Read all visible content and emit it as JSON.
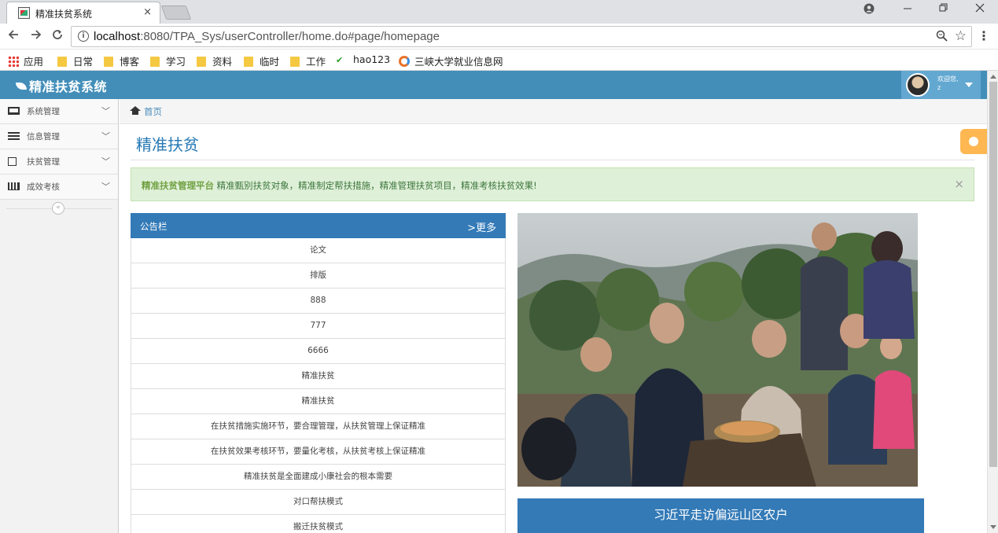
{
  "browser": {
    "tab_title": "精准扶贫系统",
    "tab_close": "×",
    "url_host": "localhost",
    "url_rest": ":8080/TPA_Sys/userController/home.do#page/homepage",
    "bookmarks": [
      "应用",
      "日常",
      "博客",
      "学习",
      "资料",
      "临时",
      "工作",
      "hao123",
      "三峡大学就业信息网"
    ]
  },
  "header": {
    "brand": "精准扶贫系统",
    "welcome_line1": "欢迎您,",
    "welcome_line2": "z"
  },
  "sidebar": {
    "items": [
      {
        "label": "系统管理",
        "icon": "monitor-icon"
      },
      {
        "label": "信息管理",
        "icon": "list-icon"
      },
      {
        "label": "扶贫管理",
        "icon": "edit-icon"
      },
      {
        "label": "成效考核",
        "icon": "bar-chart-icon"
      }
    ],
    "collapse": "«"
  },
  "breadcrumb": {
    "home": "首页"
  },
  "page": {
    "title": "精准扶贫",
    "alert_strong": "精准扶贫管理平台",
    "alert_text": " 精准甄别扶贫对象，精准制定帮扶措施，精准管理扶贫项目，精准考核扶贫效果!",
    "alert_close": "×"
  },
  "notice": {
    "title": "公告栏",
    "more": ">更多",
    "rows": [
      "论文",
      "排版",
      "888",
      "777",
      "6666",
      "精准扶贫",
      "精准扶贫",
      "在扶贫措施实施环节，要合理管理，从扶贫管理上保证精准",
      "在扶贫效果考核环节，要量化考核，从扶贫考核上保证精准",
      "精准扶贫是全面建成小康社会的根本需要",
      "对口帮扶模式",
      "搬迁扶贫模式"
    ]
  },
  "photo": {
    "caption": "习近平走访偏远山区农户"
  },
  "colors": {
    "header": "#438eb9",
    "panel": "#337ab7",
    "alert_bg": "#dff0d8",
    "settings": "#ffb752"
  }
}
